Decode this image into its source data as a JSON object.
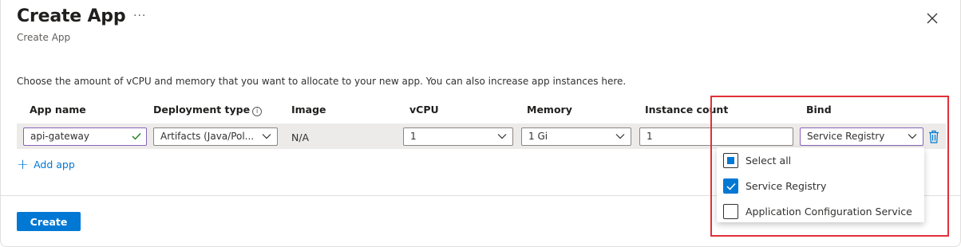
{
  "header": {
    "title": "Create App",
    "more_label": "···",
    "subtitle": "Create App"
  },
  "intro": "Choose the amount of vCPU and memory that you want to allocate to your new app. You can also increase app instances here.",
  "columns": {
    "app_name": "App name",
    "deployment_type": "Deployment type",
    "image": "Image",
    "vcpu": "vCPU",
    "memory": "Memory",
    "instance_count": "Instance count",
    "bind": "Bind"
  },
  "row": {
    "app_name": "api-gateway",
    "deployment_type": "Artifacts (Java/Pol...",
    "image": "N/A",
    "vcpu": "1",
    "memory": "1 Gi",
    "instance_count": "1",
    "bind": "Service Registry"
  },
  "add_app_label": "Add app",
  "create_label": "Create",
  "bind_options": [
    {
      "label": "Select all",
      "state": "indeterminate"
    },
    {
      "label": "Service Registry",
      "state": "checked"
    },
    {
      "label": "Application Configuration Service",
      "state": "unchecked"
    }
  ],
  "colors": {
    "accent": "#0078d4",
    "highlight": "#e03038",
    "valid_border": "#8764b8",
    "valid_check": "#107c10"
  },
  "icons": {
    "close": "close-icon",
    "info": "info-icon",
    "chevron": "chevron-down-icon",
    "trash": "trash-icon",
    "add": "plus-icon",
    "valid": "checkmark-icon"
  }
}
